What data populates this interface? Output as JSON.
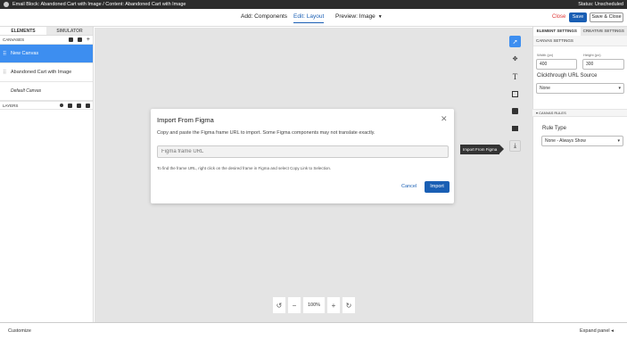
{
  "topbar": {
    "breadcrumb": "Email Block: Abandoned Cart with Image / Content: Abandoned Cart with Image",
    "status": "Status: Unscheduled"
  },
  "nav": {
    "add_components": "Add: Components",
    "edit_layout": "Edit: Layout",
    "preview": "Preview: Image",
    "close": "Close",
    "save": "Save",
    "save_close": "Save & Close"
  },
  "left": {
    "tab_elements": "ELEMENTS",
    "tab_simulator": "SIMULATOR",
    "canvases_label": "CANVASES",
    "canvases": [
      "New Canvas",
      "Abandoned Cart with Image",
      "Default Canvas"
    ],
    "layers_label": "LAYERS"
  },
  "tools": {
    "tooltip": "Import From Figma"
  },
  "zoom": {
    "level": "100%"
  },
  "right": {
    "tab_element": "ELEMENT SETTINGS",
    "tab_creative": "CREATIVE SETTINGS",
    "canvas_settings": "CANVAS SETTINGS",
    "width_label": "Width (px)",
    "width_value": "400",
    "height_label": "Height (px)",
    "height_value": "300",
    "clickthrough_label": "Clickthrough URL Source",
    "clickthrough_value": "None",
    "canvas_rules": "CANVAS RULES",
    "rule_type_label": "Rule Type",
    "rule_type_value": "None - Always Show"
  },
  "modal": {
    "title": "Import From Figma",
    "description": "Copy and paste the Figma frame URL to import. Some Figma components may not translate exactly.",
    "input_placeholder": "Figma frame URL",
    "hint": "To find the frame URL, right click on the desired frame in Figma and select Copy Link to Selection.",
    "cancel": "Cancel",
    "import": "Import"
  },
  "footer": {
    "customize": "Customize",
    "expand_panel": "Expand panel"
  }
}
